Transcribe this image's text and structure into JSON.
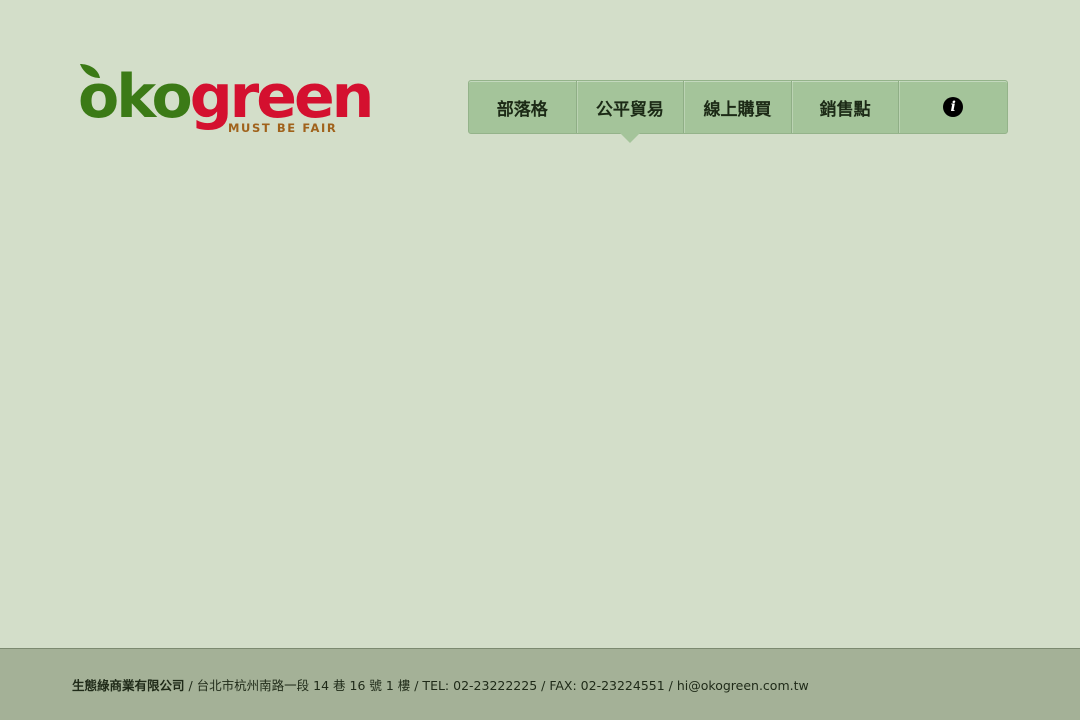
{
  "logo": {
    "part1": "oko",
    "part2": "green",
    "tagline": "MUST BE FAIR"
  },
  "nav": {
    "items": [
      {
        "label": "部落格"
      },
      {
        "label": "公平貿易",
        "active": true
      },
      {
        "label": "線上購買"
      },
      {
        "label": "銷售點"
      }
    ],
    "info_icon": "i"
  },
  "footer": {
    "company": "生態綠商業有限公司",
    "address": " / 台北市杭州南路一段 14 巷 16 號 1 樓 / TEL: 02-23222225 / FAX: 02-23224551 / ",
    "email": "hi@okogreen.com.tw"
  },
  "colors": {
    "background": "#d3dec9",
    "nav_background": "#a4c49a",
    "footer_background": "#a4b197",
    "logo_green": "#3b7a16",
    "logo_red": "#d4102f",
    "tagline": "#a0621b"
  }
}
